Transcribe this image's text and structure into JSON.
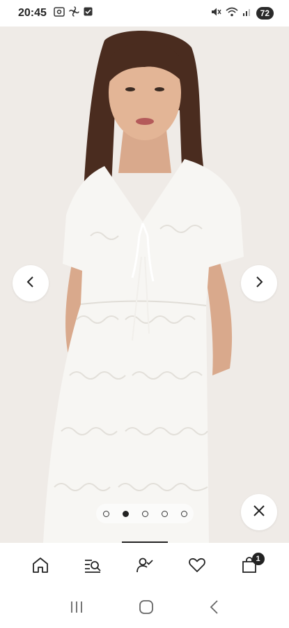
{
  "status_bar": {
    "time": "20:45",
    "battery": "72",
    "icons": [
      "screenshot-icon",
      "fan-icon",
      "checkbox-icon",
      "mute-icon",
      "wifi-icon",
      "signal-icon"
    ]
  },
  "gallery": {
    "current_index": 2,
    "total": 5,
    "icons": [
      "chevron-left-icon",
      "chevron-right-icon",
      "close-icon"
    ]
  },
  "bottom_nav": {
    "items": [
      "home-icon",
      "search-list-icon",
      "account-icon",
      "heart-icon",
      "bag-icon"
    ],
    "cart_count": "1"
  },
  "system_nav": {
    "icons": [
      "recents-icon",
      "home-circle-icon",
      "back-icon"
    ]
  },
  "colors": {
    "photo_background": "#efebe7",
    "dress": "#f7f6f3",
    "hair": "#4a2c1f",
    "accent": "#222222"
  }
}
